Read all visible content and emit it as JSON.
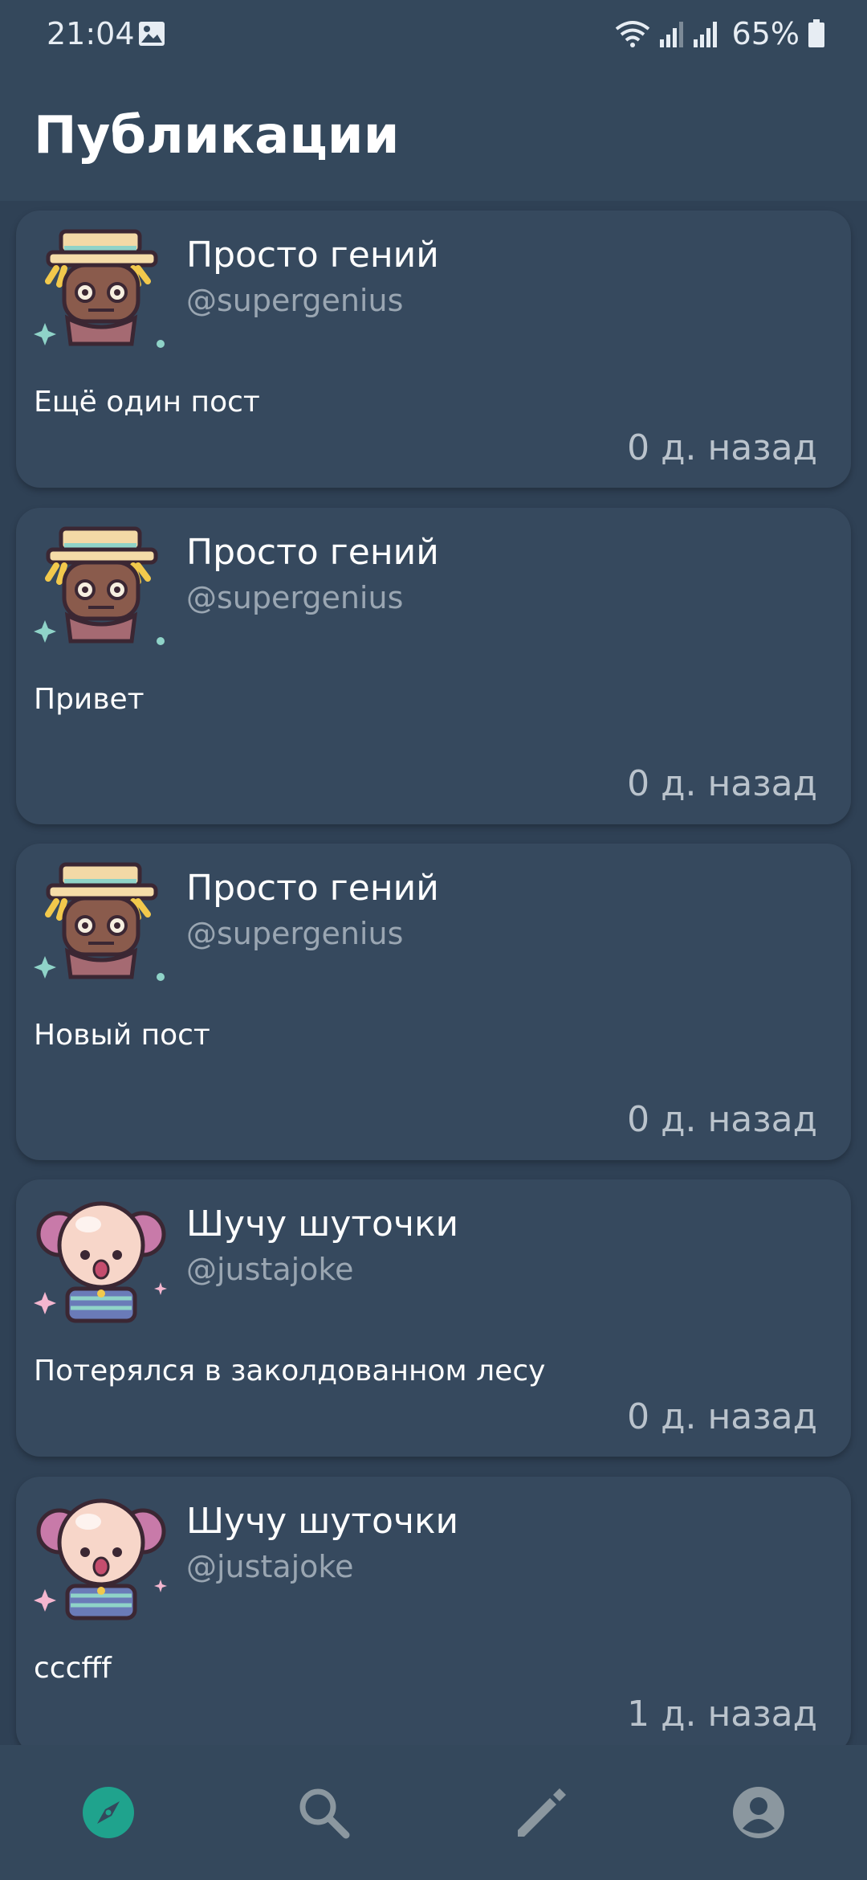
{
  "status_bar": {
    "time": "21:04",
    "battery": "65%"
  },
  "header": {
    "title": "Публикации"
  },
  "posts": [
    {
      "author_name": "Просто гений",
      "author_handle": "@supergenius",
      "text": "Ещё один пост",
      "time": "0 д. назад",
      "avatar": "scarecrow-avatar"
    },
    {
      "author_name": "Просто гений",
      "author_handle": "@supergenius",
      "text": "Привет",
      "time": "0 д. назад",
      "avatar": "scarecrow-avatar"
    },
    {
      "author_name": "Просто гений",
      "author_handle": "@supergenius",
      "text": "Новый пост",
      "time": "0 д. назад",
      "avatar": "scarecrow-avatar"
    },
    {
      "author_name": "Шучу шуточки",
      "author_handle": "@justajoke",
      "text": "Потерялся в заколдованном лесу",
      "time": "0 д. назад",
      "avatar": "clown-avatar"
    },
    {
      "author_name": "Шучу шуточки",
      "author_handle": "@justajoke",
      "text": "cccfff",
      "time": "1 д. назад",
      "avatar": "clown-avatar"
    }
  ],
  "bottom_nav": {
    "items": [
      {
        "icon": "compass-icon",
        "active": true
      },
      {
        "icon": "search-icon",
        "active": false
      },
      {
        "icon": "pencil-icon",
        "active": false
      },
      {
        "icon": "account-icon",
        "active": false
      }
    ],
    "active_color": "#1fa38d",
    "inactive_color": "#8b979f"
  }
}
